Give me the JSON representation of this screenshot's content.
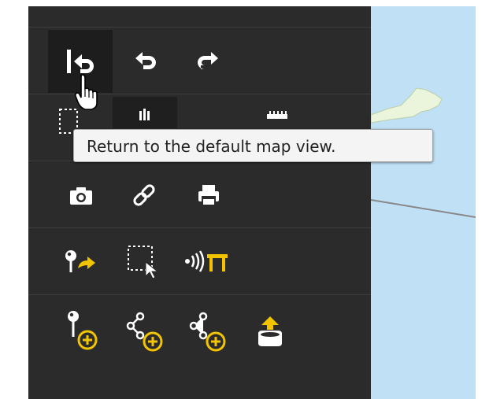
{
  "toolbar": {
    "rows": [
      {
        "name": "navigation",
        "tools": [
          {
            "id": "default-view",
            "icon": "return-to-start-icon",
            "state": "active-hover"
          },
          {
            "id": "back",
            "icon": "undo-arrow-icon"
          },
          {
            "id": "forward",
            "icon": "redo-arrow-icon"
          }
        ]
      },
      {
        "name": "selection-and-measure",
        "tools": [
          {
            "id": "zoom-box",
            "icon": "dashed-selection-icon"
          },
          {
            "id": "pan",
            "icon": "hand-pan-icon"
          },
          {
            "id": "measure",
            "icon": "ruler-icon"
          }
        ]
      },
      {
        "name": "output",
        "tools": [
          {
            "id": "screenshot",
            "icon": "camera-icon"
          },
          {
            "id": "share-link",
            "icon": "link-icon"
          },
          {
            "id": "print",
            "icon": "printer-icon"
          }
        ]
      },
      {
        "name": "analysis",
        "tools": [
          {
            "id": "route",
            "icon": "pin-route-icon"
          },
          {
            "id": "select-features",
            "icon": "select-area-cursor-icon"
          },
          {
            "id": "broadcast",
            "icon": "signal-tower-icon"
          }
        ]
      },
      {
        "name": "draw",
        "tools": [
          {
            "id": "add-point",
            "icon": "add-point-icon"
          },
          {
            "id": "add-line",
            "icon": "add-line-icon"
          },
          {
            "id": "add-polygon",
            "icon": "add-polygon-icon"
          },
          {
            "id": "upload",
            "icon": "upload-icon"
          }
        ]
      }
    ]
  },
  "tooltip": {
    "text": "Return to the default map view."
  },
  "colors": {
    "panel_background": "#2b2b2b",
    "icon_white": "#ffffff",
    "accent_yellow": "#f2c400",
    "map_water": "#bfe0f5",
    "map_land": "#eaf5dc"
  }
}
